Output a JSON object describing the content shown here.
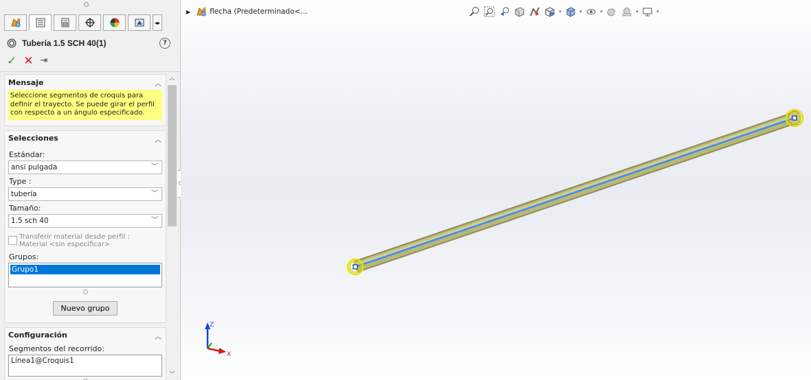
{
  "panel": {
    "tabs": [
      {
        "icon": "feature-manager-icon"
      },
      {
        "icon": "property-manager-icon"
      },
      {
        "icon": "configuration-manager-icon"
      },
      {
        "icon": "dimxpert-icon"
      },
      {
        "icon": "display-manager-icon"
      },
      {
        "icon": "cam-icon"
      }
    ],
    "title": "Tubería 1.5 SCH 40(1)",
    "help_label": "?",
    "accept_icon": "✓",
    "cancel_icon": "✕",
    "pin_icon": "⇥",
    "mensaje": {
      "heading": "Mensaje",
      "text": "Seleccione segmentos de croquis para definir el trayecto. Se puede girar el perfil con respecto a un ángulo especificado."
    },
    "selecciones": {
      "heading": "Selecciones",
      "estandar_label": "Estándar:",
      "estandar_value": "ansi pulgada",
      "type_label": "Type :",
      "type_value": "tubería",
      "tamano_label": "Tamaño:",
      "tamano_value": "1.5 sch 40",
      "transfer_label": "Transferir material desde perfil :",
      "material_label": "Material <sin especificar>",
      "grupos_label": "Grupos:",
      "grupos": [
        "Grupo1"
      ],
      "nuevo_grupo_label": "Nuevo grupo"
    },
    "configuracion": {
      "heading": "Configuración",
      "segmentos_label": "Segmentos del recorrido:",
      "segmentos_value": "Línea1@Croquis1"
    }
  },
  "viewport": {
    "tree_label": "flecha  (Predeterminado<...",
    "hud_icons": [
      "zoom-to-fit-icon",
      "zoom-area-icon",
      "previous-view-icon",
      "section-view-icon",
      "dynamic-annotation-icon",
      "view-orientation-icon",
      "display-style-icon",
      "hide-show-items-icon",
      "edit-appearance-icon",
      "apply-scene-icon",
      "view-settings-icon"
    ],
    "triad": {
      "z_label": "Z",
      "x_label": "X"
    },
    "colors": {
      "pipe": "#b9b77a",
      "path_line": "#3c8cf0",
      "endpoint_ring": "#e8e000"
    }
  }
}
